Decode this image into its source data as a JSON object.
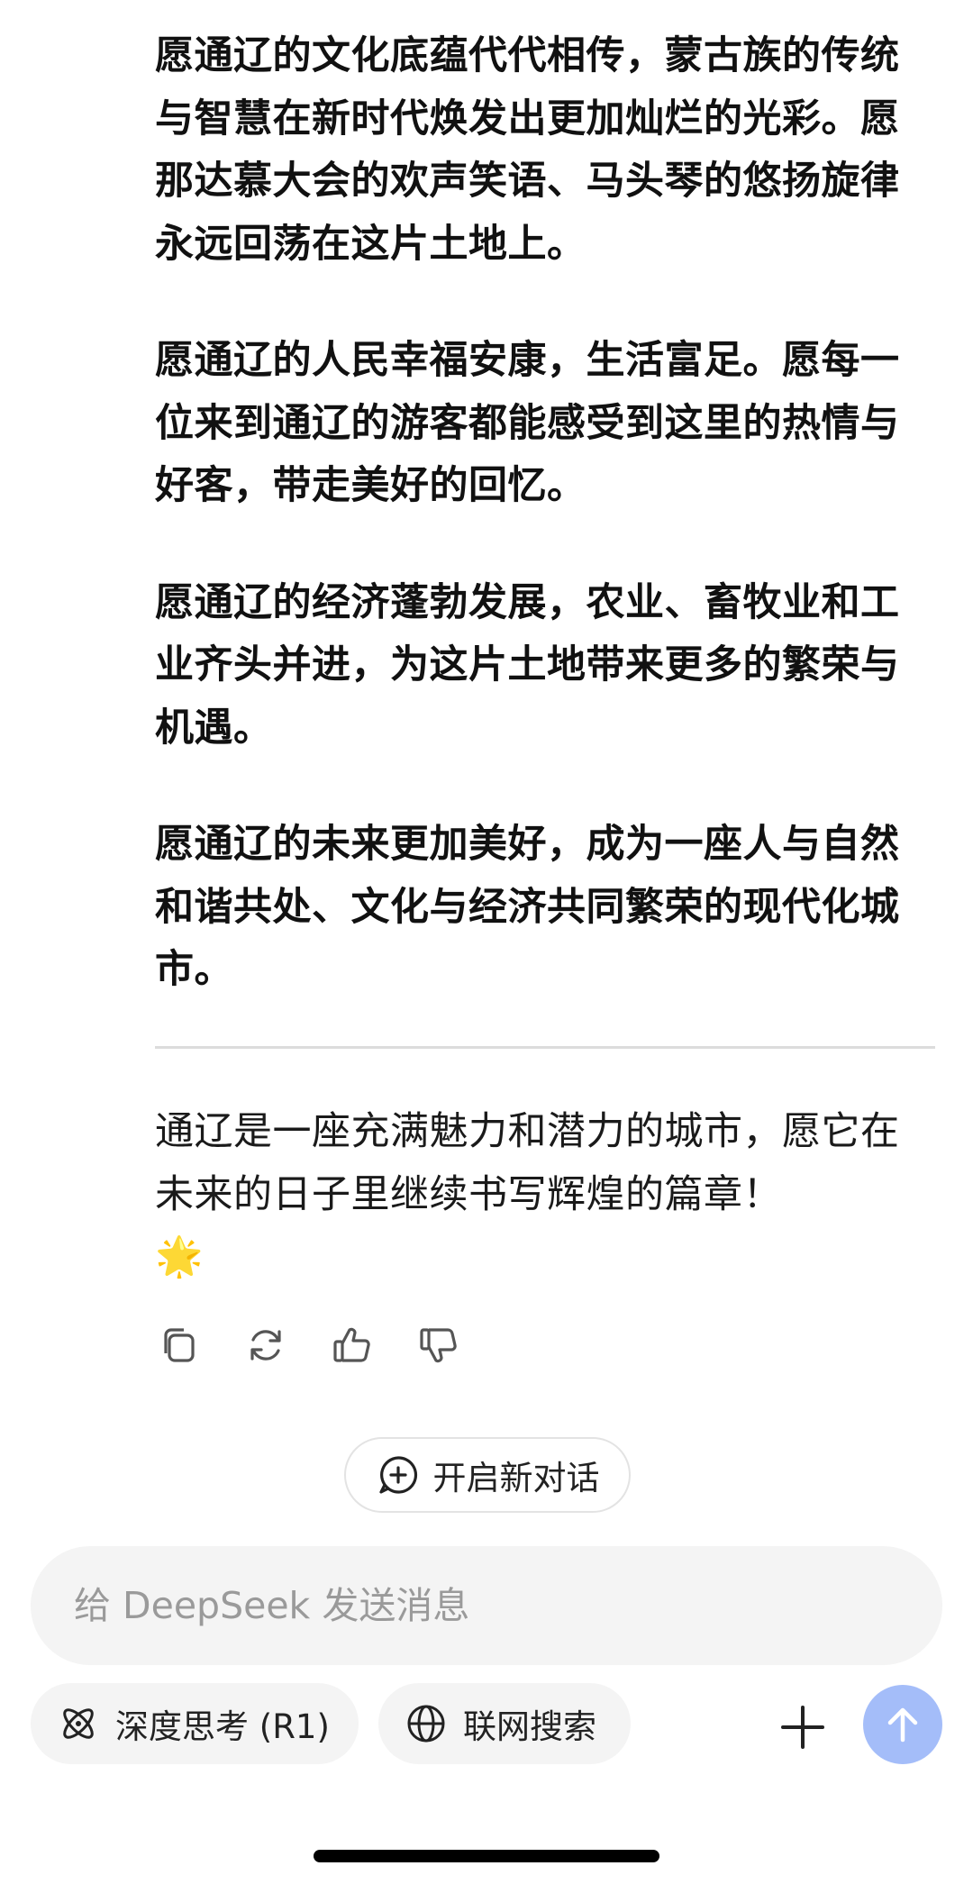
{
  "message": {
    "paragraphs": [
      "愿通辽的文化底蕴代代相传，蒙古族的传统与智慧在新时代焕发出更加灿烂的光彩。愿那达慕大会的欢声笑语、马头琴的悠扬旋律永远回荡在这片土地上。",
      "愿通辽的人民幸福安康，生活富足。愿每一位来到通辽的游客都能感受到这里的热情与好客，带走美好的回忆。",
      "愿通辽的经济蓬勃发展，农业、畜牧业和工业齐头并进，为这片土地带来更多的繁荣与机遇。",
      "愿通辽的未来更加美好，成为一座人与自然和谐共处、文化与经济共同繁荣的现代化城市。"
    ],
    "closing": "通辽是一座充满魅力和潜力的城市，愿它在未来的日子里继续书写辉煌的篇章！",
    "closing_emoji": "🌟"
  },
  "actions": {
    "icons": [
      "copy-icon",
      "regenerate-icon",
      "thumbs-up-icon",
      "thumbs-down-icon"
    ]
  },
  "new_chat": {
    "label": "开启新对话",
    "icon": "chat-plus-icon"
  },
  "composer": {
    "placeholder": "给 DeepSeek 发送消息",
    "value": "",
    "deep_think_label": "深度思考 (R1)",
    "web_search_label": "联网搜索",
    "send_color": "#a4bdf9"
  }
}
